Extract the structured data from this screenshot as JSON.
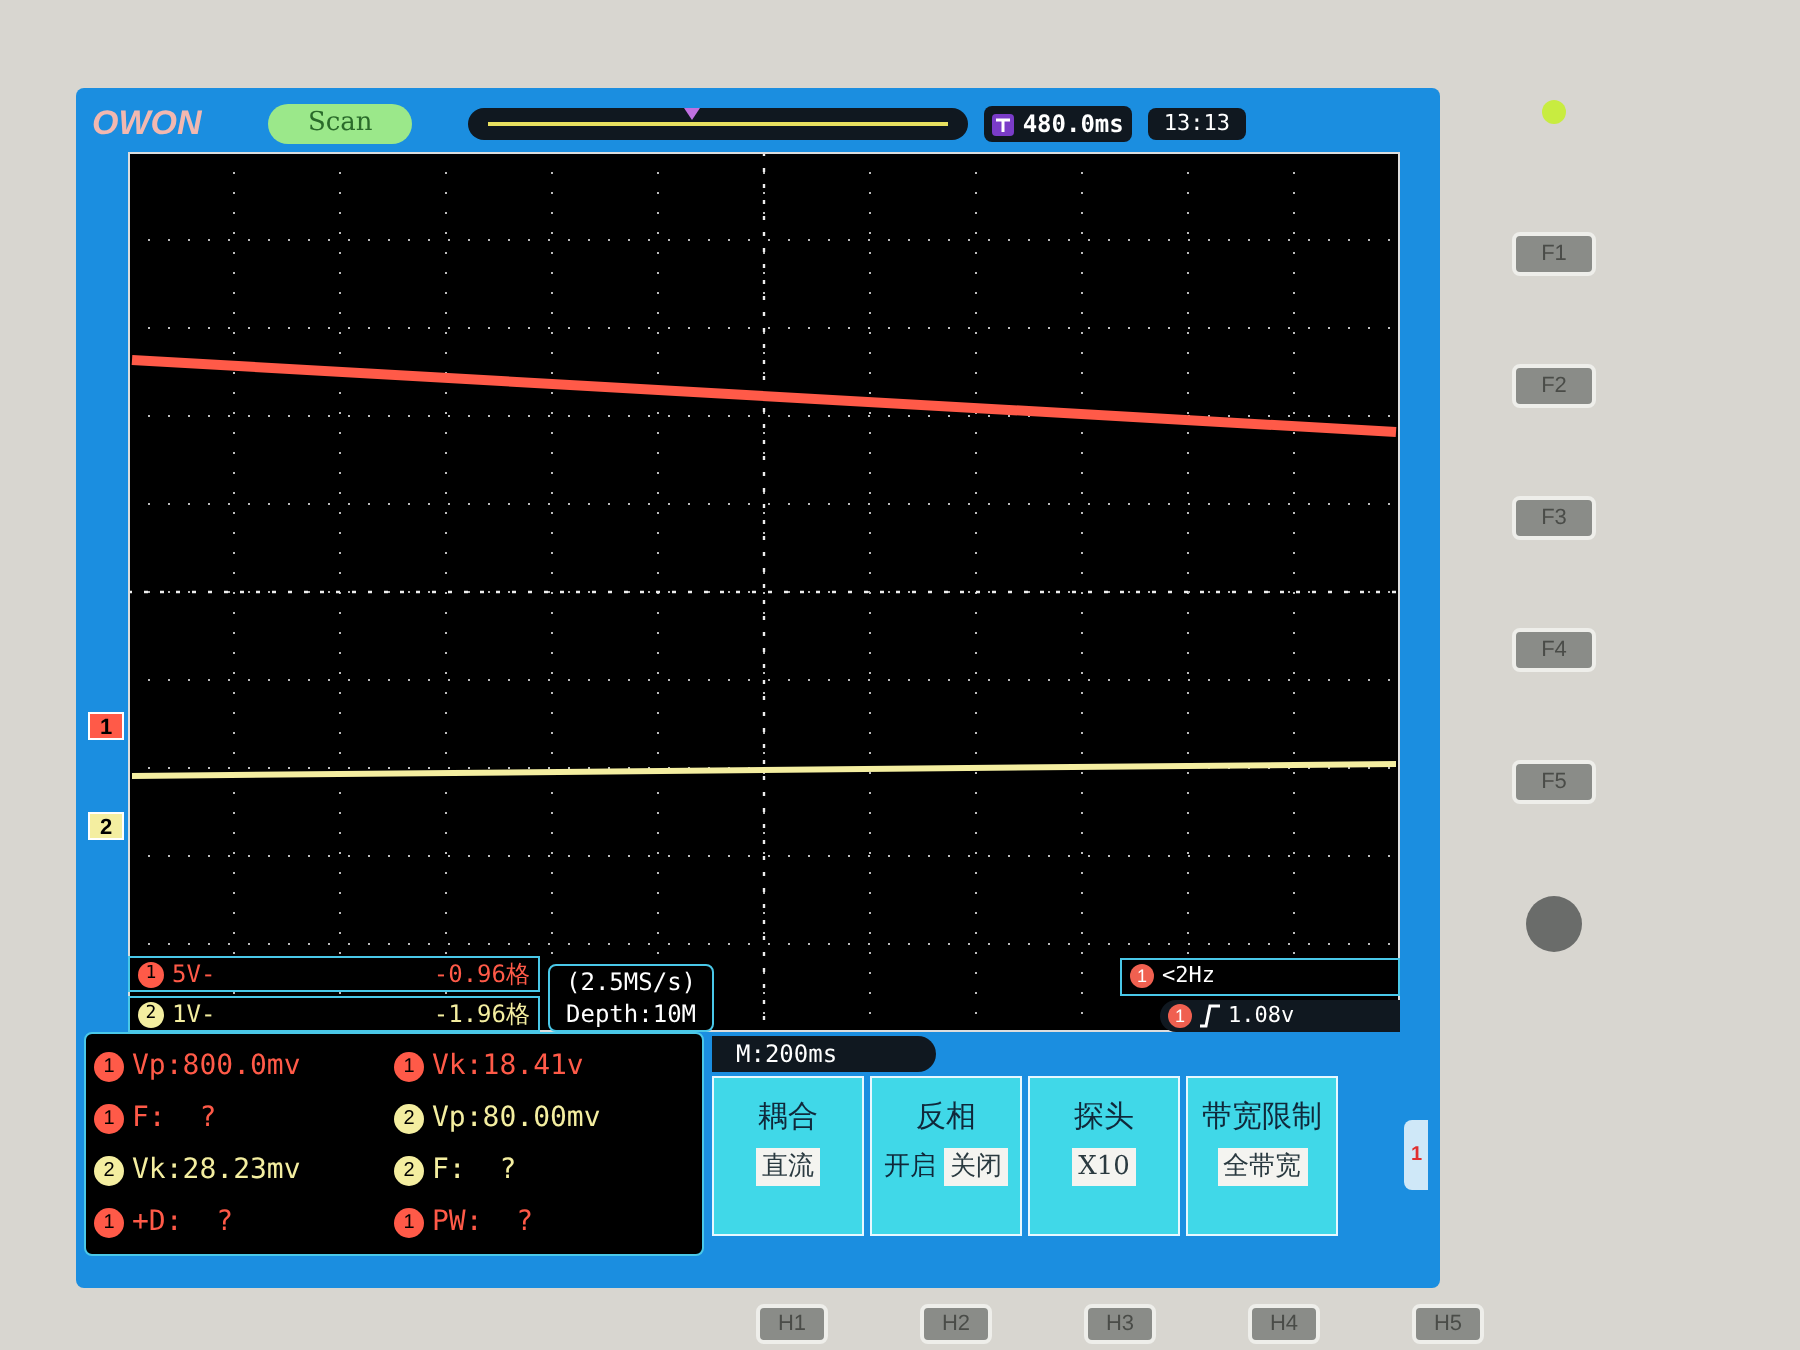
{
  "header": {
    "logo": "OWON",
    "mode": "Scan",
    "trigger_position": "480.0ms",
    "time": "13:13"
  },
  "channels": [
    {
      "marker": "1",
      "badge": "1",
      "scale": "5V-",
      "offset": "-0.96格",
      "color": "#ff5a48"
    },
    {
      "marker": "2",
      "badge": "2",
      "scale": "1V-",
      "offset": "-1.96格",
      "color": "#f4eea0"
    }
  ],
  "acquisition": {
    "rate": "(2.5MS/s)",
    "depth": "Depth:10M"
  },
  "trigger": {
    "frequency_badge": "1",
    "frequency": "<2Hz",
    "level_badge": "1",
    "level": "1.08v"
  },
  "timebase": "M:200ms",
  "measurements": [
    {
      "color": "#ff5a48",
      "badge": "1",
      "text": "Vp:800.0mv"
    },
    {
      "color": "#ff5a48",
      "badge": "1",
      "text": "Vk:18.41v"
    },
    {
      "color": "#ff5a48",
      "badge": "1",
      "text": "F:  ?"
    },
    {
      "color": "#f4eea0",
      "badge": "2",
      "text": "Vp:80.00mv"
    },
    {
      "color": "#f4eea0",
      "badge": "2",
      "text": "Vk:28.23mv"
    },
    {
      "color": "#f4eea0",
      "badge": "2",
      "text": "F:  ?"
    },
    {
      "color": "#ff5a48",
      "badge": "1",
      "text": "+D:  ?"
    },
    {
      "color": "#ff5a48",
      "badge": "1",
      "text": "PW:  ?"
    }
  ],
  "menu": [
    {
      "title": "耦合",
      "options": [
        {
          "label": "直流",
          "selected": true
        }
      ]
    },
    {
      "title": "反相",
      "options": [
        {
          "label": "开启",
          "selected": false
        },
        {
          "label": "关闭",
          "selected": true
        }
      ]
    },
    {
      "title": "探头",
      "options": [
        {
          "label": "X10",
          "selected": true
        }
      ]
    },
    {
      "title": "带宽限制",
      "options": [
        {
          "label": "全带宽",
          "selected": true
        }
      ]
    }
  ],
  "menu_channel": "1",
  "side_buttons": [
    "F1",
    "F2",
    "F3",
    "F4",
    "F5"
  ],
  "bottom_buttons": [
    "H1",
    "H2",
    "H3",
    "H4",
    "H5"
  ]
}
